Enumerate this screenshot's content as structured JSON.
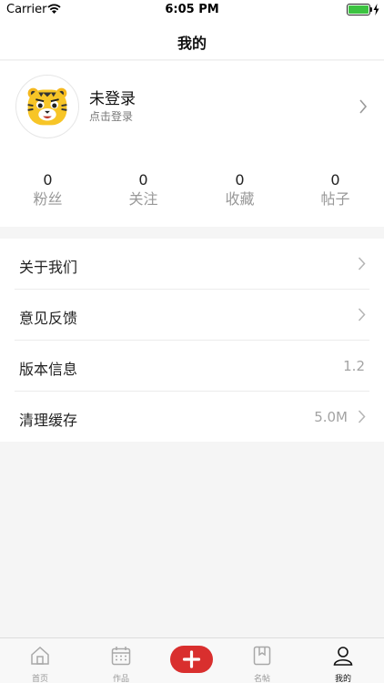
{
  "status_bar": {
    "carrier": "Carrier",
    "time": "6:05 PM"
  },
  "nav": {
    "title": "我的"
  },
  "profile": {
    "name": "未登录",
    "subtitle": "点击登录",
    "avatar_icon": "tiger-avatar-icon",
    "arrow_icon": "chevron-right-icon"
  },
  "stats": [
    {
      "value": "0",
      "label": "粉丝"
    },
    {
      "value": "0",
      "label": "关注"
    },
    {
      "value": "0",
      "label": "收藏"
    },
    {
      "value": "0",
      "label": "帖子"
    }
  ],
  "menu": [
    {
      "label": "关于我们",
      "value": "",
      "has_arrow": true
    },
    {
      "label": "意见反馈",
      "value": "",
      "has_arrow": true
    },
    {
      "label": "版本信息",
      "value": "1.2",
      "has_arrow": false
    },
    {
      "label": "清理缓存",
      "value": "5.0M",
      "has_arrow": true
    }
  ],
  "tabs": [
    {
      "label": "首页",
      "icon": "home-icon"
    },
    {
      "label": "作品",
      "icon": "calendar-icon"
    },
    {
      "label": "",
      "icon": "plus-icon"
    },
    {
      "label": "名帖",
      "icon": "bookmark-book-icon"
    },
    {
      "label": "我的",
      "icon": "person-icon",
      "active": true
    }
  ],
  "colors": {
    "accent": "#d92f2e",
    "background": "#f5f5f5",
    "secondary_text": "#999999",
    "battery": "#3cc341"
  }
}
